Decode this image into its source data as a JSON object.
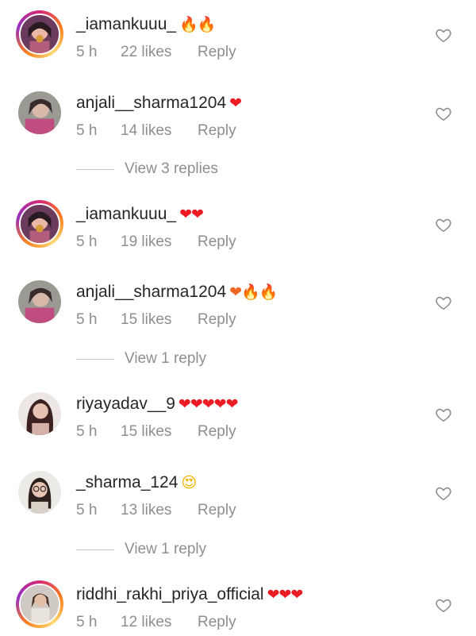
{
  "comments": [
    {
      "username": "_iamankuuu_",
      "emoji": "🔥🔥",
      "time": "5 h",
      "likes": "22 likes",
      "reply": "Reply",
      "avatar": "girl-photo-ring"
    },
    {
      "username": "anjali__sharma1204",
      "emoji": "❤",
      "time": "5 h",
      "likes": "14 likes",
      "reply": "Reply",
      "avatar": "girl-photo"
    },
    {
      "username": "_iamankuuu_",
      "emoji": "❤❤",
      "time": "5 h",
      "likes": "19 likes",
      "reply": "Reply",
      "avatar": "girl-photo-ring"
    },
    {
      "username": "anjali__sharma1204",
      "emoji": "❤🔥🔥",
      "time": "5 h",
      "likes": "15 likes",
      "reply": "Reply",
      "avatar": "girl-photo"
    },
    {
      "username": "riyayadav__9",
      "emoji": "❤❤❤❤❤",
      "time": "5 h",
      "likes": "15 likes",
      "reply": "Reply",
      "avatar": "girl-photo"
    },
    {
      "username": "_sharma_124",
      "emoji": "😍",
      "time": "5 h",
      "likes": "13 likes",
      "reply": "Reply",
      "avatar": "girl-glasses-photo"
    },
    {
      "username": "riddhi_rakhi_priya_official",
      "emoji": "❤❤❤",
      "time": "5 h",
      "likes": "12 likes",
      "reply": "Reply",
      "avatar": "girl-photo-ring"
    }
  ],
  "view_replies": [
    "View 3 replies",
    "View 1 reply",
    "View 1 reply"
  ],
  "icons": {
    "like": "heart-outline-icon"
  },
  "colors": {
    "text": "#262626",
    "muted": "#8e8e8e",
    "heart": "#ed1c24",
    "fire": "#f26522"
  }
}
